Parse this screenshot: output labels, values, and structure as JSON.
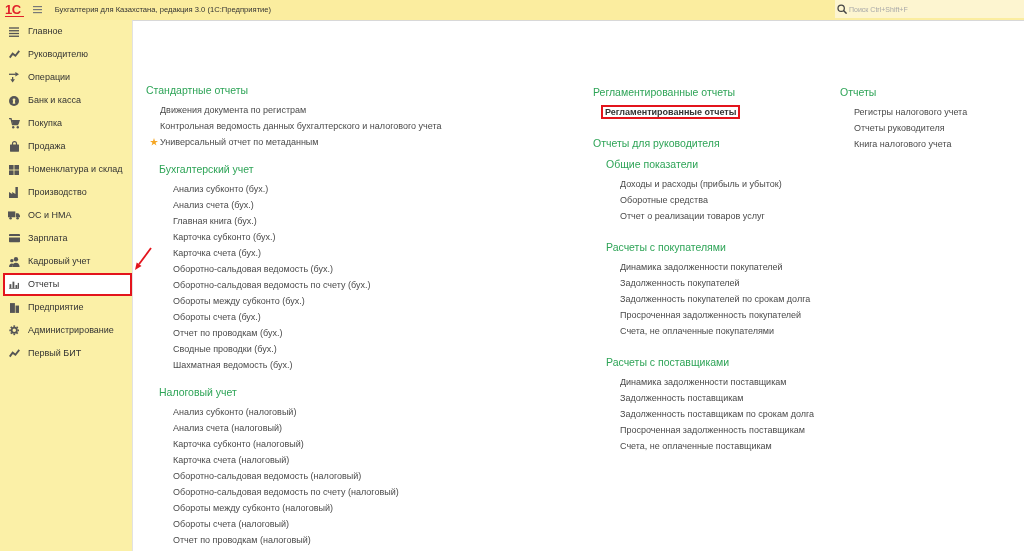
{
  "window": {
    "logo": "1С",
    "title": "Бухгалтерия для Казахстана, редакция 3.0 (1С:Предприятие)"
  },
  "search": {
    "placeholder": "Поиск Ctrl+Shift+F"
  },
  "sidebar": {
    "items": [
      {
        "label": "Главное",
        "selected": false,
        "highlighted": false
      },
      {
        "label": "Руководителю",
        "selected": false,
        "highlighted": false
      },
      {
        "label": "Операции",
        "selected": false,
        "highlighted": false
      },
      {
        "label": "Банк и касса",
        "selected": false,
        "highlighted": false
      },
      {
        "label": "Покупка",
        "selected": false,
        "highlighted": false
      },
      {
        "label": "Продажа",
        "selected": false,
        "highlighted": false
      },
      {
        "label": "Номенклатура и склад",
        "selected": false,
        "highlighted": false
      },
      {
        "label": "Производство",
        "selected": false,
        "highlighted": false
      },
      {
        "label": "ОС и НМА",
        "selected": false,
        "highlighted": false
      },
      {
        "label": "Зарплата",
        "selected": false,
        "highlighted": false
      },
      {
        "label": "Кадровый учет",
        "selected": false,
        "highlighted": false
      },
      {
        "label": "Отчеты",
        "selected": true,
        "highlighted": true
      },
      {
        "label": "Предприятие",
        "selected": false,
        "highlighted": false
      },
      {
        "label": "Администрирование",
        "selected": false,
        "highlighted": false
      },
      {
        "label": "Первый БИТ",
        "selected": false,
        "highlighted": false
      }
    ]
  },
  "report_columns": [
    {
      "sections": [
        {
          "title": "Стандартные отчеты",
          "items": [
            {
              "label": "Движения документа по регистрам",
              "favorite": false
            },
            {
              "label": "Контрольная ведомость данных бухгалтерского и налогового учета",
              "favorite": false
            },
            {
              "label": "Универсальный отчет по метаданным",
              "favorite": true
            }
          ],
          "children": [
            {
              "title": "Бухгалтерский учет",
              "items": [
                {
                  "label": "Анализ субконто (бух.)"
                },
                {
                  "label": "Анализ счета (бух.)"
                },
                {
                  "label": "Главная книга (бух.)"
                },
                {
                  "label": "Карточка субконто (бух.)"
                },
                {
                  "label": "Карточка счета (бух.)"
                },
                {
                  "label": "Оборотно-сальдовая ведомость (бух.)"
                },
                {
                  "label": "Оборотно-сальдовая ведомость по счету (бух.)"
                },
                {
                  "label": "Обороты между субконто (бух.)"
                },
                {
                  "label": "Обороты счета (бух.)"
                },
                {
                  "label": "Отчет по проводкам (бух.)"
                },
                {
                  "label": "Сводные проводки (бух.)"
                },
                {
                  "label": "Шахматная ведомость (бух.)"
                }
              ]
            },
            {
              "title": "Налоговый учет",
              "items": [
                {
                  "label": "Анализ субконто (налоговый)"
                },
                {
                  "label": "Анализ счета (налоговый)"
                },
                {
                  "label": "Карточка субконто (налоговый)"
                },
                {
                  "label": "Карточка счета (налоговый)"
                },
                {
                  "label": "Оборотно-сальдовая ведомость (налоговый)"
                },
                {
                  "label": "Оборотно-сальдовая ведомость по счету (налоговый)"
                },
                {
                  "label": "Обороты между субконто (налоговый)"
                },
                {
                  "label": "Обороты счета (налоговый)"
                },
                {
                  "label": "Отчет по проводкам (налоговый)"
                }
              ]
            }
          ]
        }
      ]
    },
    {
      "sections": [
        {
          "title": "Регламентированные отчеты",
          "items": [
            {
              "label": "Регламентированные отчеты",
              "highlighted": true
            }
          ]
        },
        {
          "title": "Отчеты для руководителя",
          "children": [
            {
              "title": "Общие показатели",
              "items": [
                {
                  "label": "Доходы и расходы (прибыль и убыток)"
                },
                {
                  "label": "Оборотные средства"
                },
                {
                  "label": "Отчет о реализации товаров услуг"
                }
              ]
            },
            {
              "title": "Расчеты с покупателями",
              "items": [
                {
                  "label": "Динамика задолженности покупателей"
                },
                {
                  "label": "Задолженность покупателей"
                },
                {
                  "label": "Задолженность покупателей по срокам долга"
                },
                {
                  "label": "Просроченная задолженность покупателей"
                },
                {
                  "label": "Счета, не оплаченные покупателями"
                }
              ]
            },
            {
              "title": "Расчеты с поставщиками",
              "items": [
                {
                  "label": "Динамика задолженности поставщикам"
                },
                {
                  "label": "Задолженность поставщикам"
                },
                {
                  "label": "Задолженность поставщикам по срокам долга"
                },
                {
                  "label": "Просроченная задолженность поставщикам"
                },
                {
                  "label": "Счета, не оплаченные поставщикам"
                }
              ]
            }
          ]
        }
      ]
    },
    {
      "sections": [
        {
          "title": "Отчеты",
          "items": [
            {
              "label": "Регистры налогового учета"
            },
            {
              "label": "Отчеты руководителя"
            },
            {
              "label": "Книга налогового учета"
            }
          ]
        }
      ]
    }
  ],
  "annotations": [
    {
      "kind": "arrow"
    }
  ]
}
